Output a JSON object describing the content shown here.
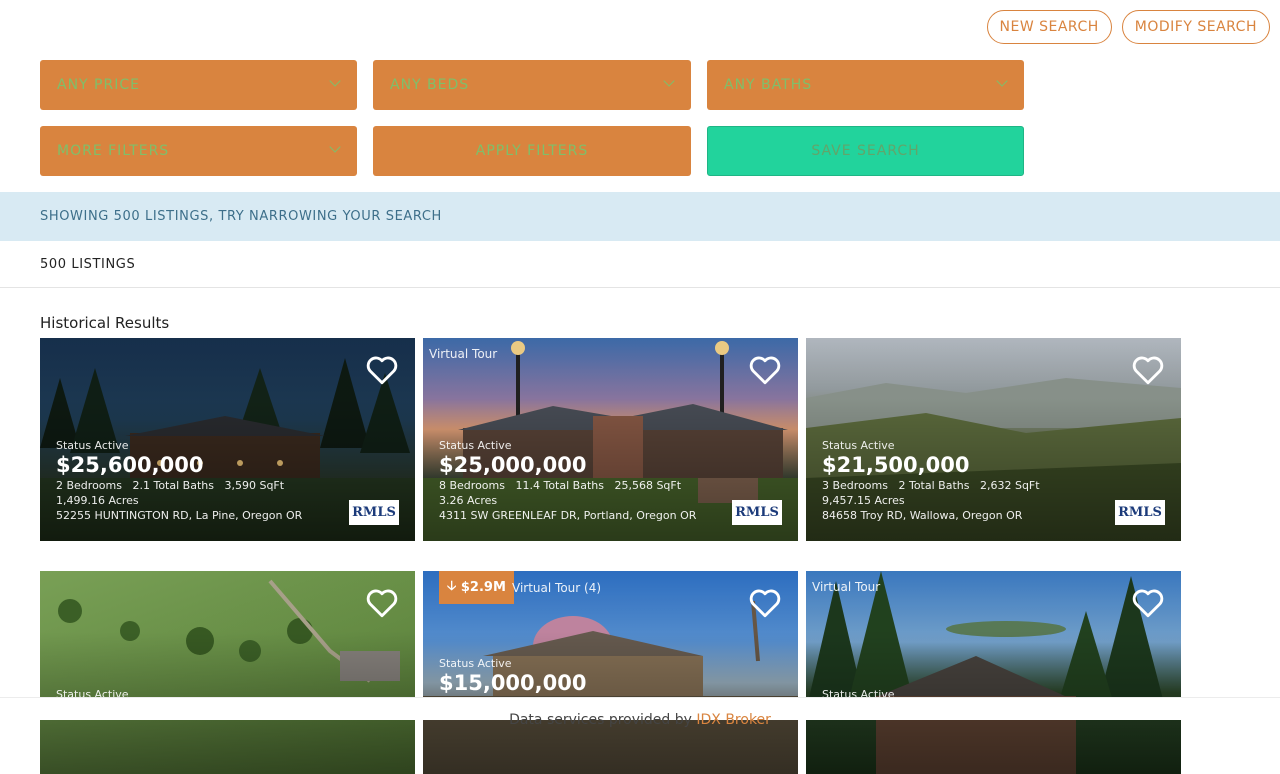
{
  "top_actions": {
    "new_search": "NEW SEARCH",
    "modify_search": "MODIFY SEARCH"
  },
  "filters": {
    "price": "ANY PRICE",
    "beds": "ANY BEDS",
    "baths": "ANY BATHS",
    "more": "MORE FILTERS",
    "apply": "APPLY FILTERS",
    "save": "SAVE SEARCH"
  },
  "notice": "SHOWING 500 LISTINGS, TRY NARROWING YOUR SEARCH",
  "listing_count": "500 LISTINGS",
  "section_title": "Historical Results",
  "listings": [
    {
      "virtual_tour": "",
      "status": "Status Active",
      "price": "$25,600,000",
      "beds": "2 Bedrooms",
      "baths": "2.1 Total Baths",
      "sqft": "3,590 SqFt",
      "acres": "1,499.16 Acres",
      "address": "52255 HUNTINGTON RD, La Pine, Oregon OR",
      "mls": "RMLS"
    },
    {
      "virtual_tour": "Virtual Tour",
      "status": "Status Active",
      "price": "$25,000,000",
      "beds": "8 Bedrooms",
      "baths": "11.4 Total Baths",
      "sqft": "25,568 SqFt",
      "acres": "3.26 Acres",
      "address": "4311 SW GREENLEAF DR, Portland, Oregon OR",
      "mls": "RMLS"
    },
    {
      "virtual_tour": "",
      "status": "Status Active",
      "price": "$21,500,000",
      "beds": "3 Bedrooms",
      "baths": "2 Total Baths",
      "sqft": "2,632 SqFt",
      "acres": "9,457.15 Acres",
      "address": "84658 Troy RD, Wallowa, Oregon OR",
      "mls": "RMLS"
    },
    {
      "virtual_tour": "",
      "status": "Status Active"
    },
    {
      "price_drop": "$2.9M",
      "virtual_tour": "Virtual Tour (4)",
      "status": "Status Active",
      "price": "$15,000,000"
    },
    {
      "virtual_tour": "Virtual Tour",
      "status": "Status Active"
    }
  ],
  "footer": {
    "text": "Data services provided by",
    "link": "IDX Broker"
  },
  "colors": {
    "accent": "#d9843f",
    "save": "#22d39c",
    "notice_bg": "#d8eaf3"
  }
}
